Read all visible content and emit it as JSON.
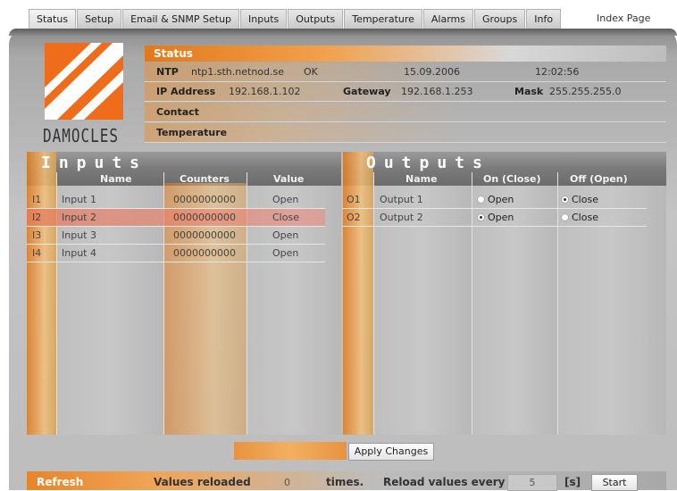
{
  "tabs": [
    "Status",
    "Setup",
    "Email & SNMP Setup",
    "Inputs",
    "Outputs",
    "Temperature",
    "Alarms",
    "Groups",
    "Info"
  ],
  "index_page": "Index Page",
  "logo": {
    "text": "DAMOCLES"
  },
  "status": {
    "title": "Status",
    "ntp_label": "NTP",
    "ntp_server": "ntp1.sth.netnod.se",
    "ntp_state": "OK",
    "date": "15.09.2006",
    "time": "12:02:56",
    "ip_label": "IP Address",
    "ip": "192.168.1.102",
    "gateway_label": "Gateway",
    "gateway": "192.168.1.253",
    "mask_label": "Mask",
    "mask": "255.255.255.0",
    "contact_label": "Contact",
    "temperature_label": "Temperature"
  },
  "inputs": {
    "title": "Inputs",
    "col_name": "Name",
    "col_counters": "Counters",
    "col_value": "Value",
    "rows": [
      {
        "id": "I1",
        "name": "Input 1",
        "counter": "0000000000",
        "value": "Open"
      },
      {
        "id": "I2",
        "name": "Input 2",
        "counter": "0000000000",
        "value": "Close"
      },
      {
        "id": "I3",
        "name": "Input 3",
        "counter": "0000000000",
        "value": "Open"
      },
      {
        "id": "I4",
        "name": "Input 4",
        "counter": "0000000000",
        "value": "Open"
      }
    ]
  },
  "outputs": {
    "title": "Outputs",
    "col_name": "Name",
    "col_on": "On (Close)",
    "col_off": "Off (Open)",
    "rows": [
      {
        "id": "O1",
        "name": "Output 1",
        "on_label": "Open",
        "off_label": "Close",
        "selected": "off"
      },
      {
        "id": "O2",
        "name": "Output 2",
        "on_label": "Open",
        "off_label": "Close",
        "selected": "on"
      }
    ]
  },
  "apply_button": "Apply Changes",
  "refresh": {
    "label": "Refresh",
    "reloaded_label": "Values reloaded",
    "reloaded_count": "0",
    "times_label": "times.",
    "reload_every_label": "Reload values every",
    "interval": "5",
    "unit": "[s]",
    "start_button": "Start"
  }
}
